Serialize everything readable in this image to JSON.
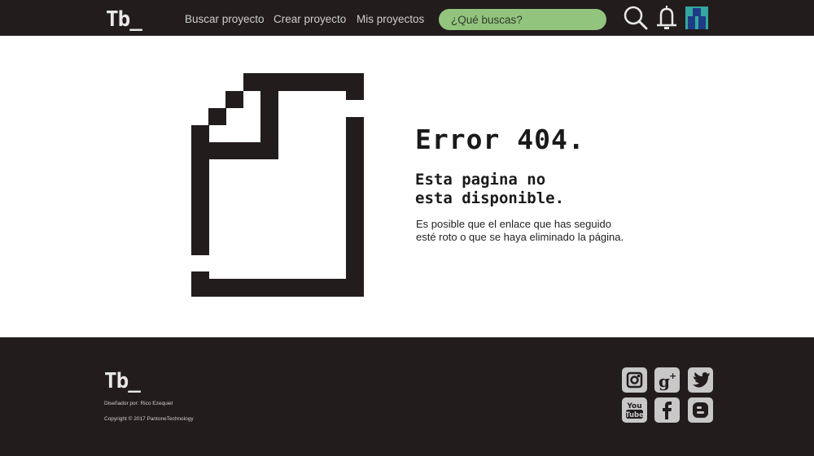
{
  "header": {
    "logo": "Tb_",
    "nav": [
      "Buscar proyecto",
      "Crear proyecto",
      "Mis proyectos"
    ],
    "search_placeholder": "¿Qué buscas?",
    "icons": [
      "search-icon",
      "bell-icon",
      "avatar"
    ]
  },
  "main": {
    "title": "Error 404.",
    "subtitle": "Esta pagina no\nesta disponible.",
    "description": "Es posible que el enlace que has seguido\nesté roto o que se haya eliminado la página.",
    "icon": "broken-document-icon"
  },
  "footer": {
    "logo": "Tb_",
    "designer": "Diseñador por: Rico Ezequiel",
    "copyright": "Copyright © 2017 PantoneTechnology",
    "social": [
      "instagram-icon",
      "google-plus-icon",
      "twitter-icon",
      "youtube-icon",
      "facebook-icon",
      "blogger-icon"
    ]
  },
  "colors": {
    "bar_bg": "#221c1d",
    "search_bg": "#93c47d",
    "social_bg": "#c8c8c8",
    "avatar": "#34a7a0"
  }
}
